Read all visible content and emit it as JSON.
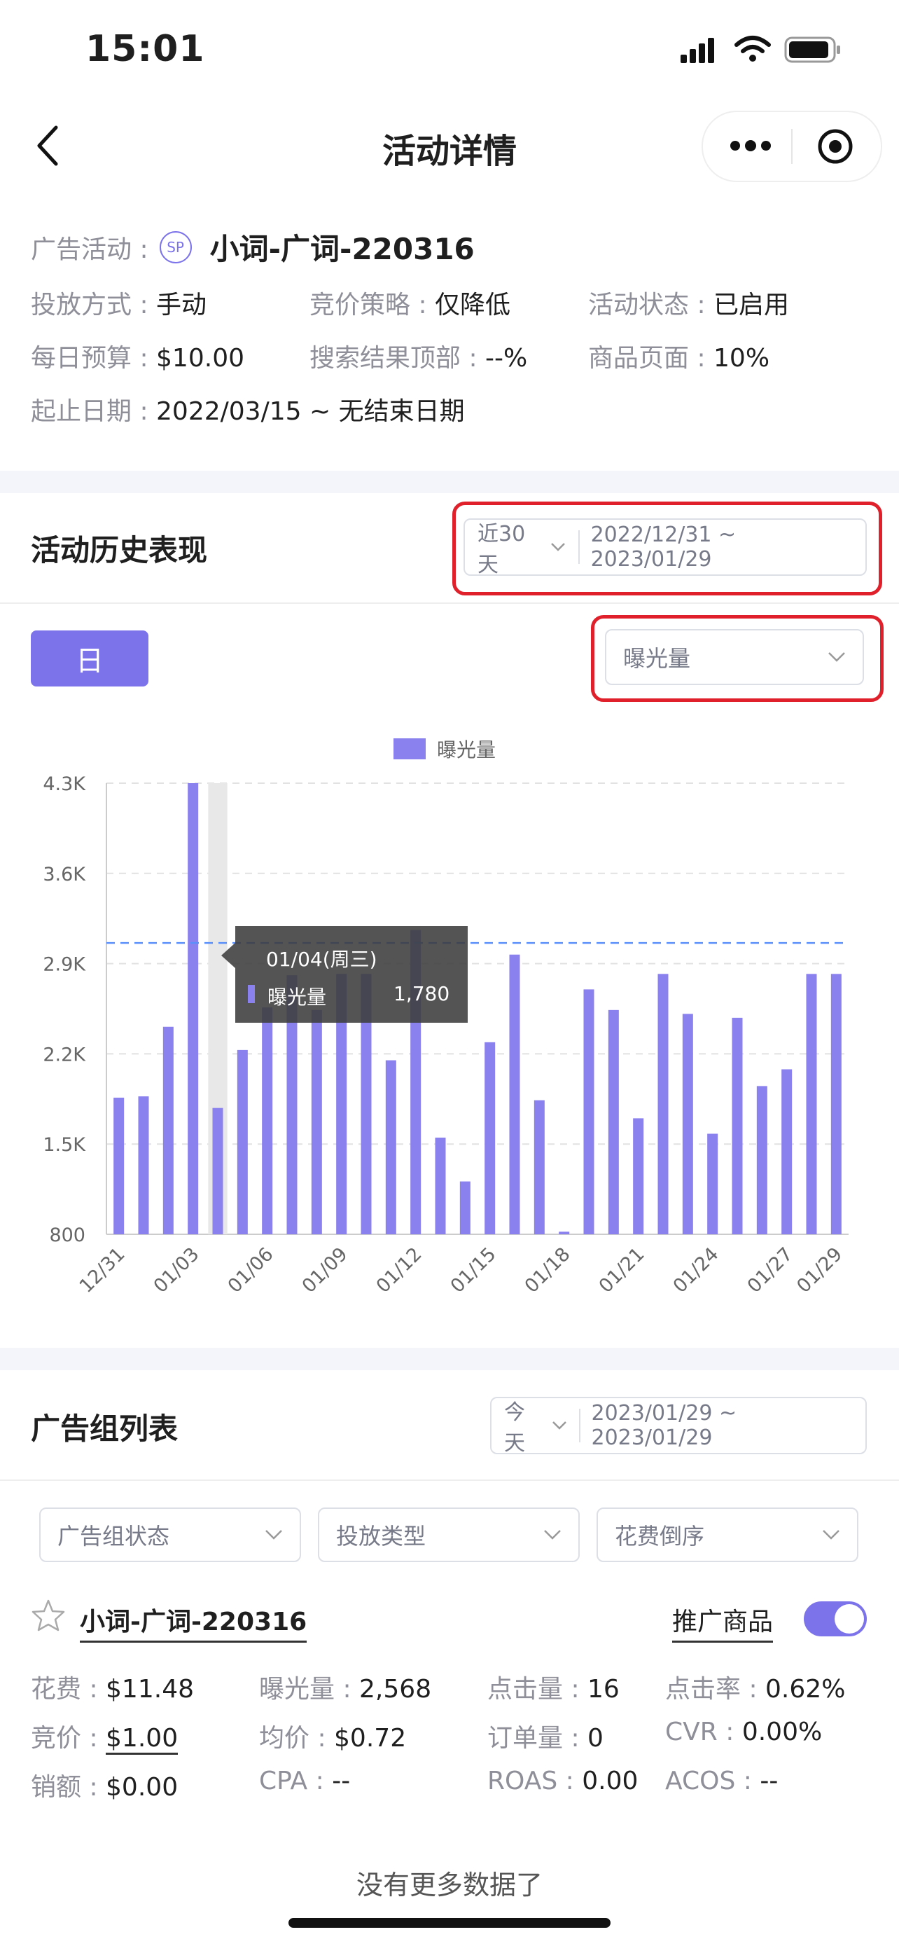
{
  "status_bar": {
    "time": "15:01"
  },
  "nav": {
    "title": "活动详情"
  },
  "campaign": {
    "label": "广告活动 :",
    "badge": "SP",
    "name": "小词-广词-220316",
    "fields": [
      {
        "label": "投放方式 :",
        "value": "手动"
      },
      {
        "label": "竞价策略 :",
        "value": "仅降低"
      },
      {
        "label": "活动状态 :",
        "value": "已启用"
      },
      {
        "label": "每日预算 :",
        "value": "$10.00"
      },
      {
        "label": "搜索结果顶部 :",
        "value": "--%"
      },
      {
        "label": "商品页面 :",
        "value": "10%"
      },
      {
        "label": "起止日期 :",
        "value": "2022/03/15 ~ 无结束日期"
      }
    ]
  },
  "history": {
    "title": "活动历史表现",
    "quick_range": "近30天",
    "date_range": "2022/12/31 ~ 2023/01/29",
    "granularity_button": "日",
    "metric_select": "曝光量"
  },
  "chart_data": {
    "type": "bar",
    "legend": "曝光量",
    "y_ticks": [
      "4.3K",
      "3.6K",
      "2.9K",
      "2.2K",
      "1.5K",
      "800"
    ],
    "ylim": [
      800,
      4300
    ],
    "x_tick_labels": [
      "12/31",
      "01/03",
      "01/06",
      "01/09",
      "01/12",
      "01/15",
      "01/18",
      "01/21",
      "01/24",
      "01/27",
      "01/29"
    ],
    "categories": [
      "12/31",
      "01/01",
      "01/02",
      "01/03",
      "01/04",
      "01/05",
      "01/06",
      "01/07",
      "01/08",
      "01/09",
      "01/10",
      "01/11",
      "01/12",
      "01/13",
      "01/14",
      "01/15",
      "01/16",
      "01/17",
      "01/18",
      "01/19",
      "01/20",
      "01/21",
      "01/22",
      "01/23",
      "01/24",
      "01/25",
      "01/26",
      "01/27",
      "01/28",
      "01/29"
    ],
    "values": [
      1860,
      1870,
      2410,
      4300,
      1780,
      2230,
      2560,
      2810,
      2540,
      2820,
      2820,
      2150,
      3160,
      1550,
      1210,
      2290,
      2970,
      1840,
      820,
      2700,
      2540,
      1700,
      2820,
      2510,
      1580,
      2480,
      1950,
      2080,
      2820,
      2820
    ],
    "average_line": 3060,
    "highlight_index": 4,
    "grid": "horizontal dashed",
    "legend_position": "top-center",
    "tooltip": {
      "date": "01/04(周三)",
      "series": "曝光量",
      "value": "1,780"
    },
    "colors": {
      "bar": "#8a80ee",
      "avg": "#5b8ff9"
    }
  },
  "adgroup": {
    "title": "广告组列表",
    "quick_range": "今天",
    "date_range": "2023/01/29 ~ 2023/01/29",
    "filters": [
      "广告组状态",
      "投放类型",
      "花费倒序"
    ],
    "item": {
      "name": "小词-广词-220316",
      "promo_label": "推广商品",
      "toggle_on": true,
      "stats": [
        {
          "label": "花费 :",
          "value": "$11.48"
        },
        {
          "label": "曝光量 :",
          "value": "2,568"
        },
        {
          "label": "点击量 :",
          "value": "16"
        },
        {
          "label": "点击率 :",
          "value": "0.62%"
        },
        {
          "label": "竞价 :",
          "value": "$1.00"
        },
        {
          "label": "均价 :",
          "value": "$0.72"
        },
        {
          "label": "订单量 :",
          "value": "0"
        },
        {
          "label": "CVR :",
          "value": "0.00%"
        },
        {
          "label": "销额 :",
          "value": "$0.00"
        },
        {
          "label": "CPA :",
          "value": "--"
        },
        {
          "label": "ROAS :",
          "value": "0.00"
        },
        {
          "label": "ACOS :",
          "value": "--"
        }
      ]
    },
    "no_more": "没有更多数据了"
  },
  "colors": {
    "accent": "#7c73eb",
    "highlight_box": "#e0202a"
  }
}
